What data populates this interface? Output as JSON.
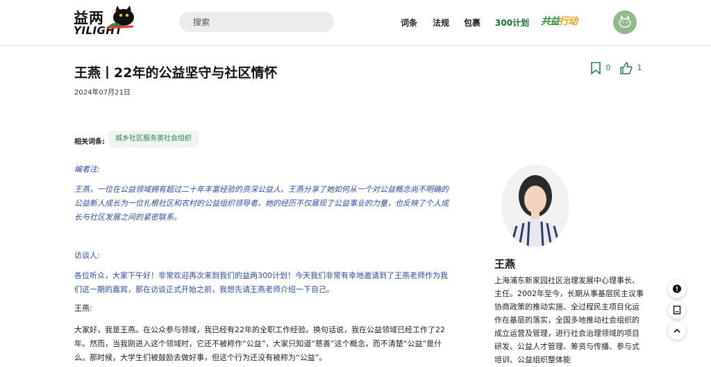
{
  "header": {
    "logo_cn": "益两",
    "logo_en": "YILIGHT",
    "search_placeholder": "搜索",
    "nav": [
      "词条",
      "法规",
      "包裹",
      "300计划"
    ],
    "campaign": {
      "part1": "共益",
      "part2": "行动"
    }
  },
  "article": {
    "title": "王燕丨22年的公益坚守与社区情怀",
    "date": "2024年07月21日",
    "bookmark_count": "0",
    "like_count": "1",
    "tags_label": "相关词条:",
    "tag": "城乡社区服务类社会组织",
    "editor_label": "编者注:",
    "editor_note": "王燕，一位在公益领域拥有超过二十年丰富经验的资深公益人。王燕分享了她如何从一个对公益概念尚不明确的公益新人成长为一位扎根社区和农村的公益组织领导者。她的经历不仅展现了公益事业的力量，也反映了个人成长与社区发展之间的紧密联系。",
    "interviewer_label": "访谈人:",
    "interviewer_text": "各位听众，大家下午好！非常欢迎再次来到我们的益两300计划！今天我们非常有幸地邀请到了王燕老师作为我们这一期的嘉宾，那在访谈正式开始之前，我想先请王燕老师介绍一下自己。",
    "speaker_label": "王燕:",
    "speaker_text": "大家好，我是王燕。在公众参与领域，我已经有22年的全职工作经验。换句话说，我在公益领域已经工作了22年。然而，当我刚进入这个领域时，它还不被称作“公益”，大家只知道“慈善”这个概念，而不清楚“公益”是什么。那时候，大学生们被鼓励去做好事，但这个行为还没有被称为“公益”。"
  },
  "sidebar": {
    "name": "王燕",
    "bio": "上海浦东新家园社区治理发展中心理事长、主任。2002年至今，长期从事基层民主议事协商政策的推动实施、全过程民主项目化运作在基层的落实，全国多地推动社会组织的成立运营及管理，进行社会治理领域的项目研发、公益人才管理、筹资与传播、参与式培训、公益组织整体能"
  },
  "colors": {
    "accent": "#2e7d4f",
    "quote_blue": "#2b4aa3"
  }
}
